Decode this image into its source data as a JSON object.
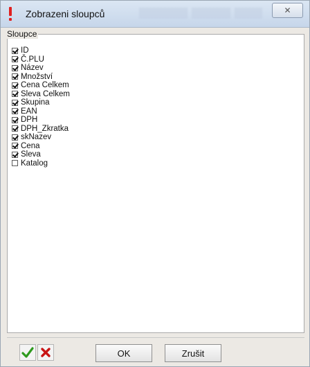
{
  "window": {
    "title": "Zobrazeni sloupců",
    "close_label": "✕"
  },
  "group": {
    "legend": "Sloupce"
  },
  "columns": [
    {
      "label": "ID",
      "checked": true
    },
    {
      "label": "Č.PLU",
      "checked": true
    },
    {
      "label": "Název",
      "checked": true
    },
    {
      "label": "Množství",
      "checked": true
    },
    {
      "label": "Cena Celkem",
      "checked": true
    },
    {
      "label": "Sleva Celkem",
      "checked": true
    },
    {
      "label": "Skupina",
      "checked": true
    },
    {
      "label": "EAN",
      "checked": true
    },
    {
      "label": "DPH",
      "checked": true
    },
    {
      "label": "DPH_Zkratka",
      "checked": true
    },
    {
      "label": "skNazev",
      "checked": true
    },
    {
      "label": "Cena",
      "checked": true
    },
    {
      "label": "Sleva",
      "checked": true
    },
    {
      "label": "Katalog",
      "checked": false
    }
  ],
  "buttons": {
    "ok_label": "OK",
    "cancel_label": "Zrušit"
  },
  "toolbar": {
    "check_all_icon": "green-check-icon",
    "uncheck_all_icon": "red-x-icon"
  },
  "colors": {
    "check_green": "#2e9a1e",
    "x_red": "#c81414",
    "title_icon_red": "#e02020"
  }
}
